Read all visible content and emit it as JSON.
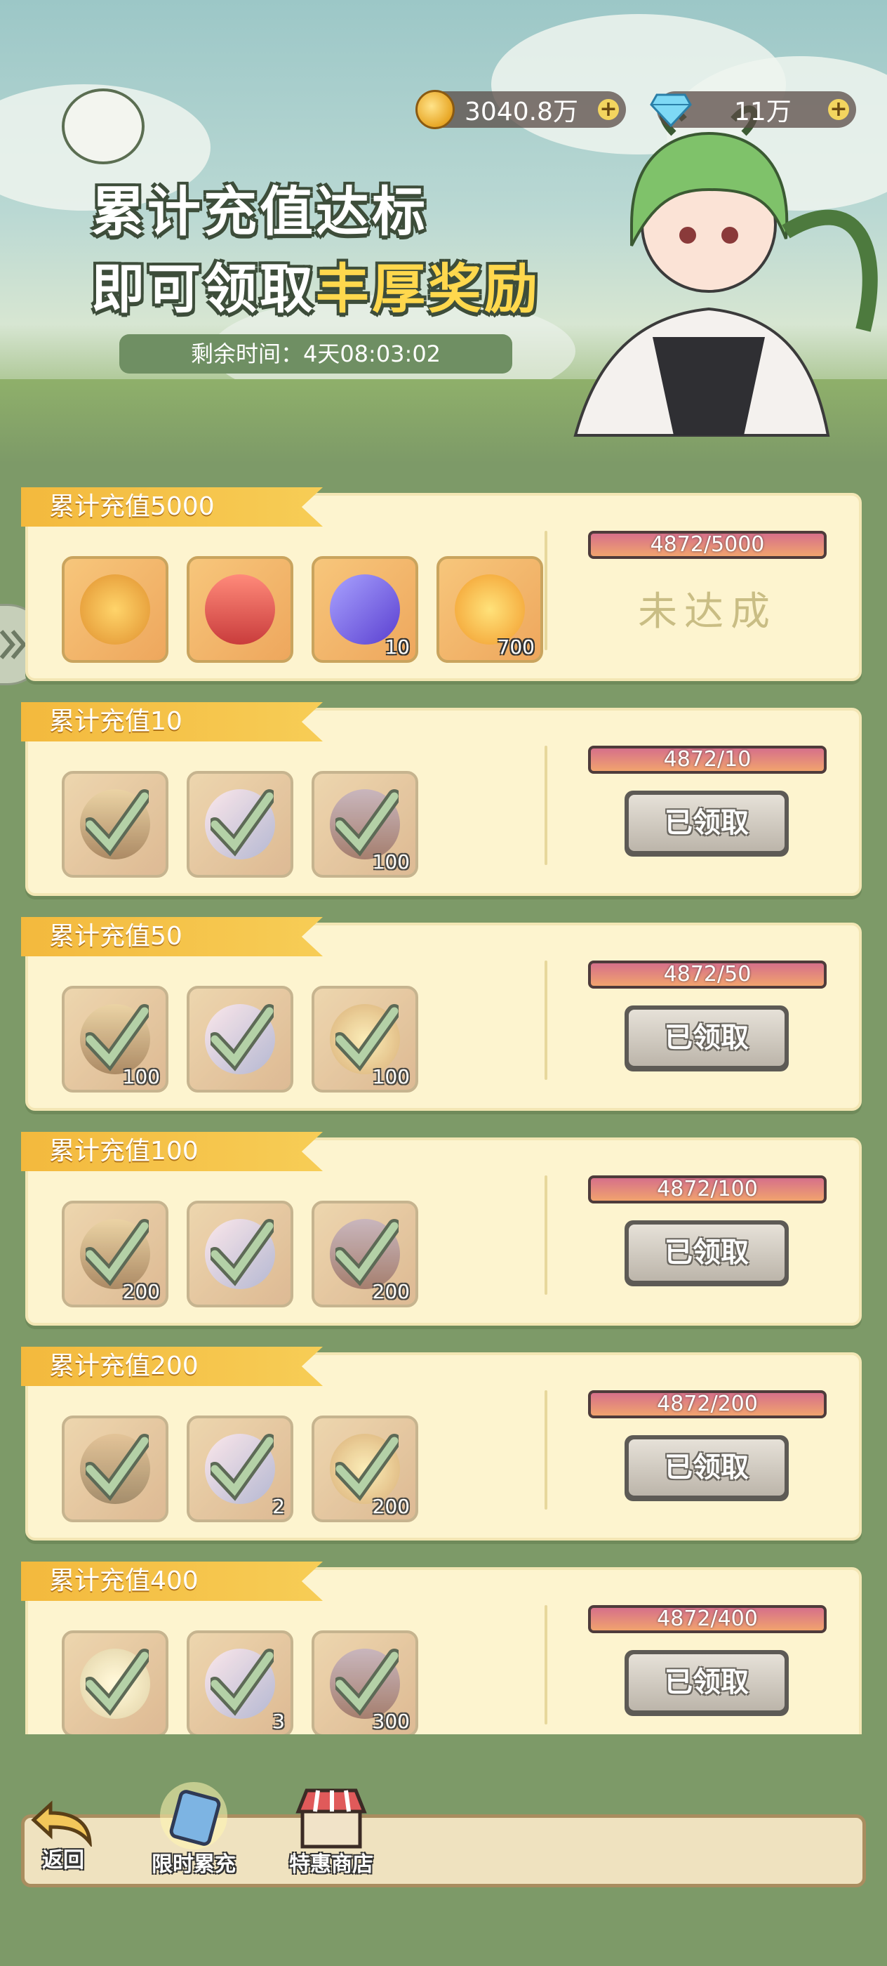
{
  "header": {
    "gold": "3040.8万",
    "diamond": "11万",
    "title_line1": "累计充值达标",
    "title_line2_prefix": "即可领取",
    "title_line2_highlight": "丰厚奖励",
    "timer_label": "剩余时间：",
    "timer_value": "4天08:03:02"
  },
  "tiers": [
    {
      "label": "累计充值5000",
      "progress": "4872/5000",
      "status": "未达成",
      "claimed": false,
      "items": [
        {
          "icon": "wealth-badge-icon",
          "qty": ""
        },
        {
          "icon": "ssr-chest-icon",
          "qty": ""
        },
        {
          "icon": "purple-gem-icon",
          "qty": "10"
        },
        {
          "icon": "gold-fruit-icon",
          "qty": "700"
        }
      ]
    },
    {
      "label": "累计充值10",
      "progress": "4872/10",
      "status": "已领取",
      "claimed": true,
      "items": [
        {
          "icon": "treasure-chest-icon",
          "qty": ""
        },
        {
          "icon": "pink-crystal-icon",
          "qty": ""
        },
        {
          "icon": "onion-crate-icon",
          "qty": "100"
        }
      ]
    },
    {
      "label": "累计充值50",
      "progress": "4872/50",
      "status": "已领取",
      "claimed": true,
      "items": [
        {
          "icon": "treasure-chest-icon",
          "qty": "100"
        },
        {
          "icon": "pink-crystal-icon",
          "qty": ""
        },
        {
          "icon": "gold-fruit-icon",
          "qty": "100"
        }
      ]
    },
    {
      "label": "累计充值100",
      "progress": "4872/100",
      "status": "已领取",
      "claimed": true,
      "items": [
        {
          "icon": "treasure-chest-icon",
          "qty": "200"
        },
        {
          "icon": "pink-crystal-icon",
          "qty": ""
        },
        {
          "icon": "onion-crate-icon",
          "qty": "200"
        }
      ]
    },
    {
      "label": "累计充值200",
      "progress": "4872/200",
      "status": "已领取",
      "claimed": true,
      "items": [
        {
          "icon": "fruit-chest-icon",
          "qty": ""
        },
        {
          "icon": "pink-crystal-icon",
          "qty": "2"
        },
        {
          "icon": "gold-fruit-icon",
          "qty": "200"
        }
      ]
    },
    {
      "label": "累计充值400",
      "progress": "4872/400",
      "status": "已领取",
      "claimed": true,
      "items": [
        {
          "icon": "egg-icon",
          "qty": ""
        },
        {
          "icon": "pink-crystal-icon",
          "qty": "3"
        },
        {
          "icon": "onion-crate-icon",
          "qty": "300"
        }
      ]
    }
  ],
  "nav": {
    "back": "返回",
    "limited_recharge": "限时累充",
    "special_shop": "特惠商店"
  }
}
